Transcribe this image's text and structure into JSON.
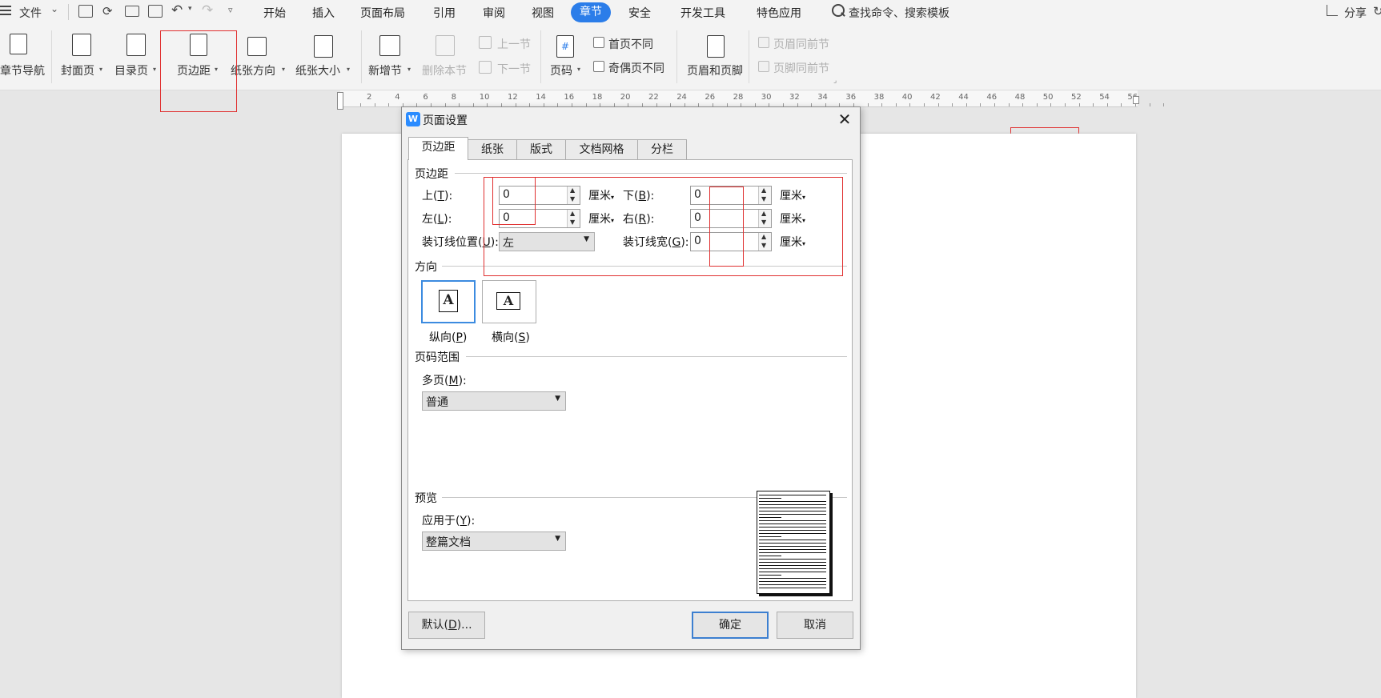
{
  "menu": {
    "file_label": "文件",
    "tabs": [
      "开始",
      "插入",
      "页面布局",
      "引用",
      "审阅",
      "视图",
      "章节",
      "安全",
      "开发工具",
      "特色应用"
    ],
    "active_tab": "章节",
    "search_label": "查找命令、搜索模板",
    "share_label": "分享"
  },
  "ribbon": {
    "chapter_nav": "章节导航",
    "cover_page": "封面页",
    "toc_page": "目录页",
    "margins": "页边距",
    "orientation": "纸张方向",
    "paper_size": "纸张大小",
    "new_section": "新增节",
    "delete_section": "删除本节",
    "prev_section": "上一节",
    "next_section": "下一节",
    "page_number": "页码",
    "first_page_diff": "首页不同",
    "odd_even_diff": "奇偶页不同",
    "header_footer": "页眉和页脚",
    "header_same_prev": "页眉同前节",
    "footer_same_prev": "页脚同前节"
  },
  "ruler": {
    "labels": [
      "2",
      "4",
      "6",
      "8",
      "10",
      "12",
      "14",
      "16",
      "18",
      "20",
      "22",
      "24",
      "26",
      "28",
      "30",
      "32",
      "34",
      "36",
      "38",
      "40",
      "42",
      "44",
      "46",
      "48",
      "50",
      "52",
      "54",
      "56"
    ]
  },
  "dialog": {
    "title": "页面设置",
    "logo": "W",
    "tabs": [
      "页边距",
      "纸张",
      "版式",
      "文档网格",
      "分栏"
    ],
    "active_tab": "页边距",
    "margins_section": "页边距",
    "top_label": "上(",
    "top_key": "T",
    "bottom_label": "下(",
    "bottom_key": "B",
    "left_label": "左(",
    "left_key": "L",
    "right_label": "右(",
    "right_key": "R",
    "gutter_pos_label": "装订线位置(",
    "gutter_pos_key": "U",
    "gutter_width_label": "装订线宽(",
    "gutter_width_key": "G",
    "close_paren": "):",
    "top_value": "0",
    "bottom_value": "0",
    "left_value": "0",
    "right_value": "0",
    "gutter_position": "左",
    "gutter_width": "0",
    "unit": "厘米",
    "orientation_section": "方向",
    "portrait_label": "纵向(",
    "portrait_key": "P",
    "landscape_label": "横向(",
    "landscape_key": "S",
    "orientation_icon_letter": "A",
    "close_paren_plain": ")",
    "page_range_section": "页码范围",
    "multi_page_label": "多页(",
    "multi_page_key": "M",
    "multi_page_value": "普通",
    "preview_section": "预览",
    "apply_to_label": "应用于(",
    "apply_to_key": "Y",
    "apply_to_value": "整篇文档",
    "default_button_pre": "默认(",
    "default_button_key": "D",
    "default_button_post": ")...",
    "ok_button": "确定",
    "cancel_button": "取消"
  },
  "colors": {
    "accent": "#2b7de9",
    "annotation_red": "#e03030"
  }
}
